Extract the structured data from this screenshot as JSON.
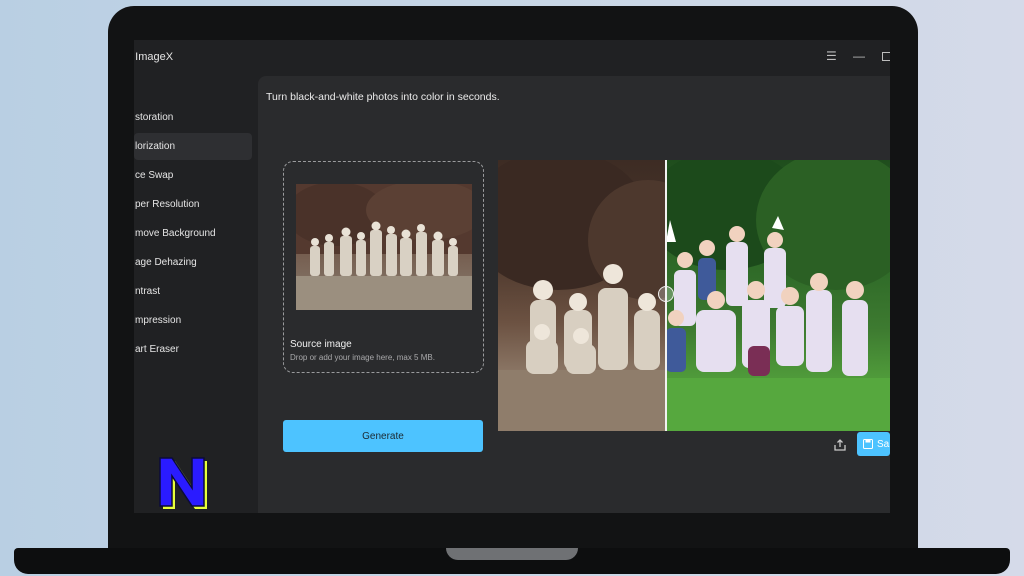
{
  "app": {
    "title": "e ImageX"
  },
  "window_controls": {
    "menu_glyph": "☰",
    "minimize_glyph": "—"
  },
  "sidebar": {
    "items": [
      {
        "label": "storation"
      },
      {
        "label": "lorization"
      },
      {
        "label": "ce Swap"
      },
      {
        "label": "per Resolution"
      },
      {
        "label": "move Background"
      },
      {
        "label": "age Dehazing"
      },
      {
        "label": "ntrast"
      },
      {
        "label": "mpression"
      },
      {
        "label": "art Eraser"
      }
    ],
    "active_index": 1
  },
  "main": {
    "tagline": "Turn black-and-white photos into color in seconds.",
    "dropzone": {
      "title": "Source image",
      "hint": "Drop or add your image here, max 5 MB."
    },
    "generate_label": "Generate",
    "save_label": "Sa"
  },
  "colors": {
    "accent": "#4dc3ff",
    "logo_fill": "#2a1bff",
    "logo_shadow": "#e7ff3a"
  },
  "icons": {
    "share": "share-icon",
    "save": "save-icon",
    "compare_handle": "compare-handle-icon"
  }
}
